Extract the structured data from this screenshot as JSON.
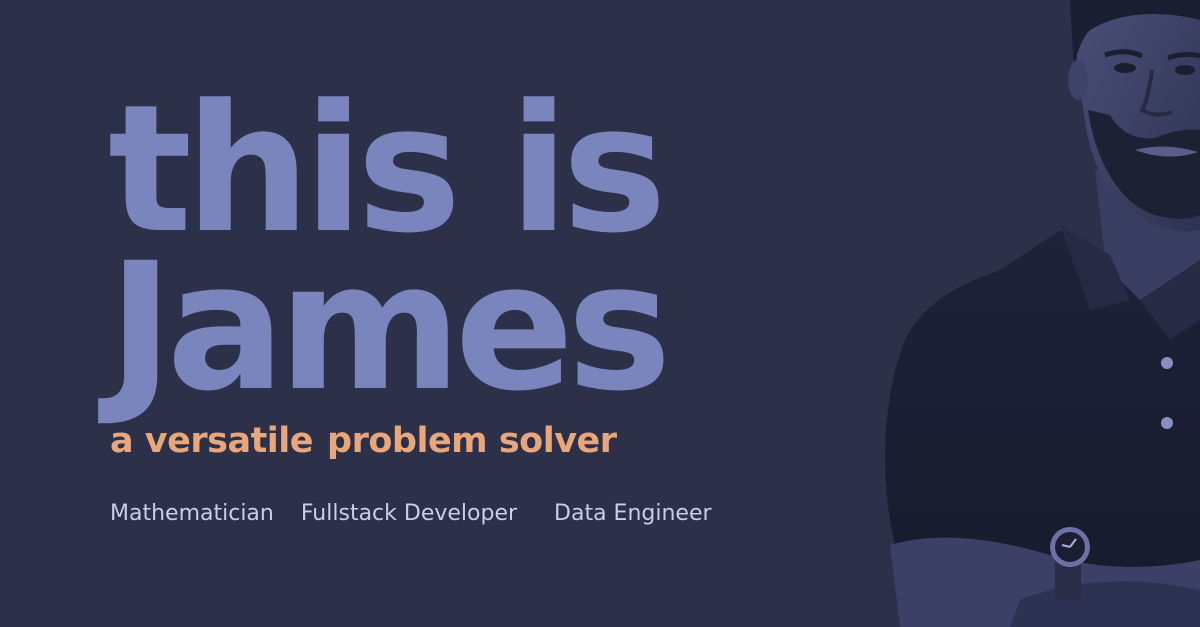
{
  "headline": {
    "line1": "this is",
    "line2": "James"
  },
  "tagline": {
    "part1": "a versatile",
    "part2": "problem solver"
  },
  "roles": [
    "Mathematician",
    "Fullstack Developer",
    "Data Engineer"
  ],
  "colors": {
    "background": "#2c3049",
    "headline": "#7b85bd",
    "tagline": "#e8a67a",
    "roles": "#c9cde6"
  },
  "portrait": {
    "icon": "person-portrait-icon"
  }
}
